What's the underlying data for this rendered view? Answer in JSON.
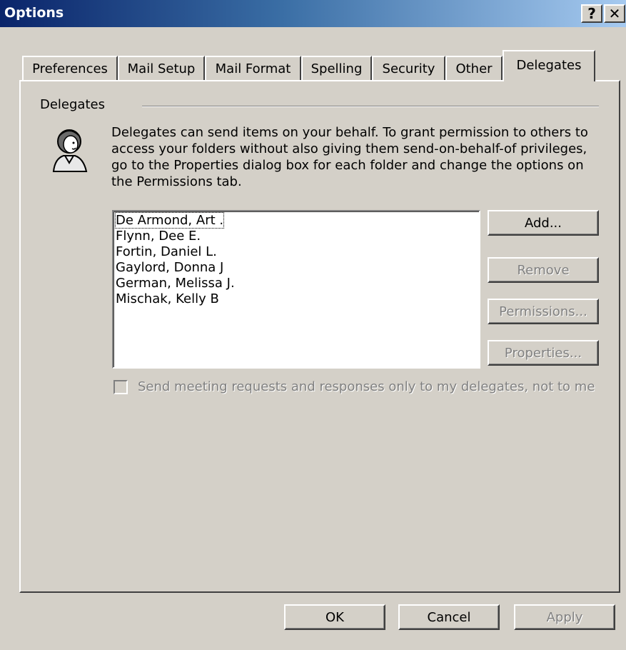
{
  "window": {
    "title": "Options",
    "help_glyph": "?",
    "close_glyph": "✕"
  },
  "tabs": [
    {
      "label": "Preferences"
    },
    {
      "label": "Mail Setup"
    },
    {
      "label": "Mail Format"
    },
    {
      "label": "Spelling"
    },
    {
      "label": "Security"
    },
    {
      "label": "Other"
    },
    {
      "label": "Delegates",
      "active": true
    }
  ],
  "delegates": {
    "group_label": "Delegates",
    "icon": "person-icon",
    "description": "Delegates can send items on your behalf. To grant permission to others to access your folders without also giving them send-on-behalf-of privileges, go to the Properties dialog box for each folder and change the options on the Permissions tab.",
    "list": [
      "De Armond, Art .",
      "Flynn, Dee E.",
      "Fortin, Daniel L.",
      "Gaylord, Donna J",
      "German, Melissa J.",
      "Mischak, Kelly B"
    ],
    "buttons": {
      "add": "Add...",
      "remove": "Remove",
      "permissions": "Permissions...",
      "properties": "Properties..."
    },
    "checkbox_label": "Send meeting requests and responses only to my delegates, not to me",
    "checkbox_checked": false
  },
  "footer": {
    "ok": "OK",
    "cancel": "Cancel",
    "apply": "Apply"
  },
  "colors": {
    "face": "#d4d0c8",
    "title_start": "#0a246a",
    "title_end": "#a6caf0",
    "disabled_text": "#808080"
  }
}
